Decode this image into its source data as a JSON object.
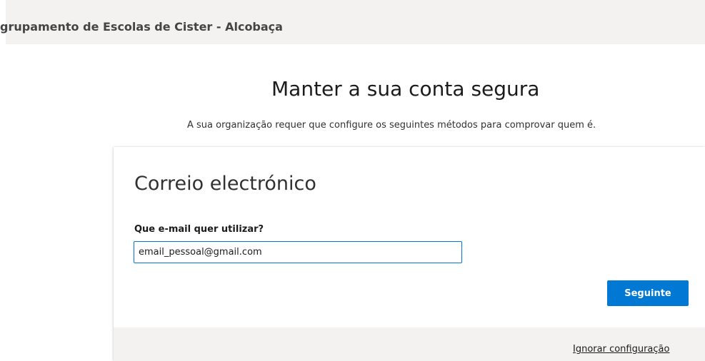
{
  "header": {
    "organization_name": "grupamento de Escolas de Cister - Alcobaça"
  },
  "main": {
    "title": "Manter a sua conta segura",
    "subtitle": "A sua organização requer que configure os seguintes métodos para comprovar quem é."
  },
  "card": {
    "title": "Correio electrónico",
    "email_label": "Que e-mail quer utilizar?",
    "email_value": "email_pessoal@gmail.com",
    "next_label": "Seguinte",
    "skip_label": "Ignorar configuração"
  },
  "colors": {
    "accent": "#0078d4",
    "header_background": "#f3f2f1",
    "footer_background": "#f3f2f1"
  }
}
